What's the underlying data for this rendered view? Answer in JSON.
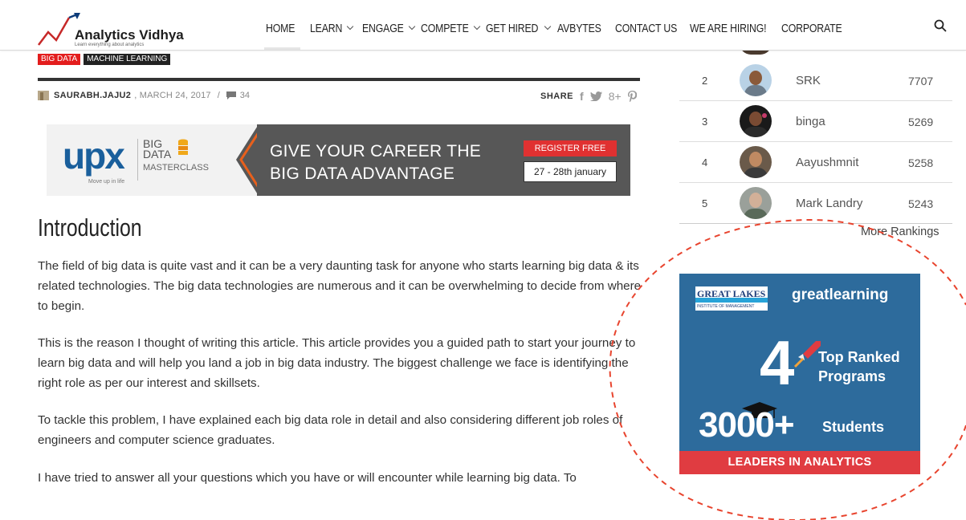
{
  "header": {
    "logo_title": "Analytics Vidhya",
    "logo_tagline": "Learn everything about analytics",
    "nav": [
      {
        "label": "HOME",
        "dropdown": false
      },
      {
        "label": "LEARN",
        "dropdown": true
      },
      {
        "label": "ENGAGE",
        "dropdown": true
      },
      {
        "label": "COMPETE",
        "dropdown": true
      },
      {
        "label": "GET HIRED",
        "dropdown": true
      },
      {
        "label": "AVBYTES",
        "dropdown": false
      },
      {
        "label": "CONTACT US",
        "dropdown": false
      },
      {
        "label": "WE ARE HIRING!",
        "dropdown": false
      },
      {
        "label": "CORPORATE",
        "dropdown": false
      }
    ],
    "search_icon": "search-icon"
  },
  "article": {
    "tags": [
      "BIG DATA",
      "MACHINE LEARNING"
    ],
    "author": "SAURABH.JAJU2",
    "date": ", MARCH 24, 2017",
    "separator": "/",
    "comments": "34",
    "share_label": "SHARE",
    "share_icons": [
      "f",
      "🐦",
      "8+",
      "P"
    ],
    "banner": {
      "brand": "upx",
      "brand_tag": "Move up in life",
      "big_data": "BIG\nDATA",
      "masterclass": "MASTERCLASS",
      "headline1": "GIVE YOUR CAREER THE",
      "headline2": "BIG DATA ADVANTAGE",
      "register": "REGISTER FREE",
      "dates": "27 - 28th january"
    },
    "title": "Introduction",
    "paragraphs": [
      "The field of big data is quite vast and it can be a very daunting task for anyone who starts learning big data & its related technologies. The big data technologies are numerous and it can be overwhelming to decide from where to begin.",
      "This is the reason I thought of writing this article. This article provides you a guided path to start your journey to learn big data and will help you land a job in big data industry.  The biggest challenge we face is identifying the right role as per our interest and skillsets.",
      "To tackle this problem, I have explained each big data role in detail and also considering different job roles of engineers and computer science graduates.",
      "I have tried to answer all your questions which you have or will encounter while learning big data. To"
    ]
  },
  "leaderboard": {
    "rows": [
      {
        "rank": "2",
        "name": "SRK",
        "score": "7707"
      },
      {
        "rank": "3",
        "name": "binga",
        "score": "5269"
      },
      {
        "rank": "4",
        "name": "Aayushmnit",
        "score": "5258"
      },
      {
        "rank": "5",
        "name": "Mark Landry",
        "score": "5243"
      }
    ],
    "more": "More Rankings"
  },
  "ad": {
    "partner": "GREAT LAKES",
    "partner_sub": "INSTITUTE OF MANAGEMENT",
    "brand": "greatlearning",
    "big_number": "4",
    "ranked": "Top Ranked\nPrograms",
    "students_count": "3000+",
    "students_label": "Students",
    "footer": "LEADERS IN ANALYTICS"
  },
  "colors": {
    "tag_red": "#e31d1d",
    "ad_blue": "#2d6b9c",
    "ad_red": "#e03c41",
    "annotation": "#e8442e"
  }
}
